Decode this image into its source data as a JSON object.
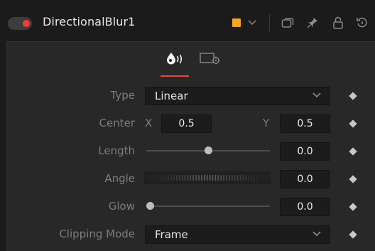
{
  "header": {
    "title": "DirectionalBlur1",
    "color_swatch": "#f5a623",
    "icons": [
      "power-toggle",
      "color-swatch",
      "chevron-down-icon",
      "window-icon",
      "pin-icon",
      "lock-icon",
      "reset-icon"
    ]
  },
  "tabs": [
    {
      "name": "controls-tab",
      "icon": "drop-icon",
      "active": true
    },
    {
      "name": "settings-tab",
      "icon": "settings-icon",
      "active": false
    }
  ],
  "controls": {
    "type": {
      "label": "Type",
      "value": "Linear"
    },
    "center": {
      "label": "Center",
      "x_label": "X",
      "x_value": "0.5",
      "y_label": "Y",
      "y_value": "0.5"
    },
    "length": {
      "label": "Length",
      "value": "0.0",
      "slider_fraction": 0.5
    },
    "angle": {
      "label": "Angle",
      "value": "0.0"
    },
    "glow": {
      "label": "Glow",
      "value": "0.0",
      "slider_fraction": 0.0
    },
    "clipping_mode": {
      "label": "Clipping Mode",
      "value": "Frame"
    }
  },
  "colors": {
    "accent_red": "#e04c3a",
    "power_red": "#ff3a30",
    "swatch_orange": "#f5a623"
  }
}
